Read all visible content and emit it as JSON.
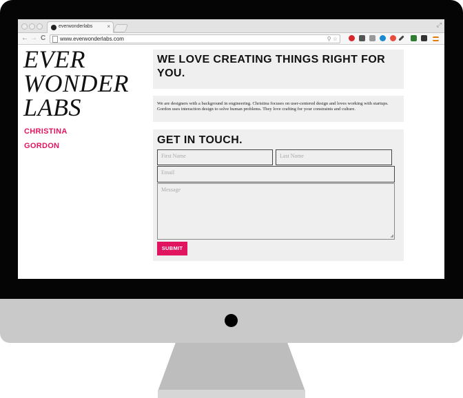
{
  "browser": {
    "tab_title": "everwonderlabs",
    "tab_close": "×",
    "url": "www.everwonderlabs.com",
    "back_glyph": "←",
    "forward_glyph": "→",
    "reload_glyph": "C",
    "expand_glyph": "⤢",
    "url_icons": "⚲ ☆"
  },
  "site": {
    "logo_lines": [
      "EVER",
      "WONDER",
      "LABS"
    ],
    "people": [
      "CHRISTINA",
      "GORDON"
    ],
    "headline": "WE LOVE CREATING THINGS RIGHT FOR YOU.",
    "about": "We are designers with a background in engineering. Christina focuses on user-centered design and loves working with startups. Gordon uses interaction design to solve human problems. They love crafting for your constraints and culture.",
    "contact": {
      "title": "GET IN TOUCH.",
      "first_name_placeholder": "First Name",
      "last_name_placeholder": "Last Name",
      "email_placeholder": "Email",
      "message_placeholder": "Message",
      "submit_label": "SUBMIT"
    }
  },
  "colors": {
    "accent": "#e0145f",
    "panel": "#efefef",
    "bezel": "#050505",
    "chin": "#c9c9c9"
  }
}
